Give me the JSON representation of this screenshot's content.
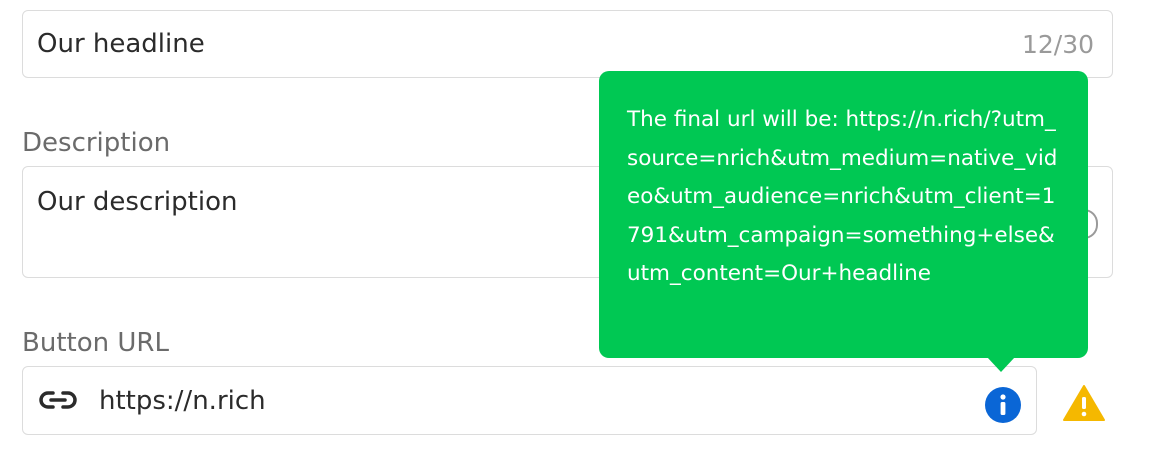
{
  "headline": {
    "value": "Our headline",
    "counter": "12/30"
  },
  "description": {
    "label": "Description",
    "value": "Our description"
  },
  "button_url": {
    "label": "Button URL",
    "value": "https://n.rich"
  },
  "tooltip": {
    "text": "The final url will be: https://n.rich/?utm_source=nrich&utm_medium=native_video&utm_audience=nrich&utm_client=1791&utm_campaign=something+else&utm_content=Our+headline"
  },
  "icons": {
    "link": "link-icon",
    "info": "info-icon",
    "warning": "warning-icon",
    "info_color": "#0a66d6",
    "warning_color": "#f5b800",
    "tooltip_color": "#00c853"
  }
}
